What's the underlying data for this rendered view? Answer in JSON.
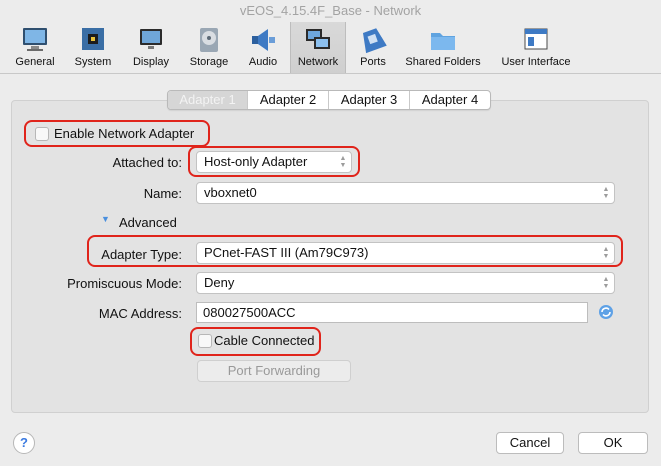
{
  "window": {
    "title": "vEOS_4.15.4F_Base - Network"
  },
  "toolbar": {
    "items": [
      {
        "label": "General",
        "icon": "monitor-icon"
      },
      {
        "label": "System",
        "icon": "chip-icon"
      },
      {
        "label": "Display",
        "icon": "display-icon"
      },
      {
        "label": "Storage",
        "icon": "disk-icon"
      },
      {
        "label": "Audio",
        "icon": "speaker-icon"
      },
      {
        "label": "Network",
        "icon": "network-icon",
        "active": true
      },
      {
        "label": "Ports",
        "icon": "ports-icon"
      },
      {
        "label": "Shared Folders",
        "icon": "folder-icon"
      },
      {
        "label": "User Interface",
        "icon": "window-icon"
      }
    ]
  },
  "tabs": [
    {
      "label": "Adapter 1",
      "selected": true
    },
    {
      "label": "Adapter 2"
    },
    {
      "label": "Adapter 3"
    },
    {
      "label": "Adapter 4"
    }
  ],
  "form": {
    "enable_adapter_label": "Enable Network Adapter",
    "attached_to_label": "Attached to:",
    "attached_to_value": "Host-only Adapter",
    "name_label": "Name:",
    "name_value": "vboxnet0",
    "advanced_label": "Advanced",
    "adapter_type_label": "Adapter Type:",
    "adapter_type_value": "PCnet-FAST III (Am79C973)",
    "promiscuous_label": "Promiscuous Mode:",
    "promiscuous_value": "Deny",
    "mac_label": "MAC Address:",
    "mac_value": "080027500ACC",
    "cable_label": "Cable Connected",
    "port_forwarding_label": "Port Forwarding"
  },
  "footer": {
    "help_label": "?",
    "cancel_label": "Cancel",
    "ok_label": "OK"
  },
  "colors": {
    "highlight": "#e0241b",
    "accent": "#3b7ae0"
  }
}
